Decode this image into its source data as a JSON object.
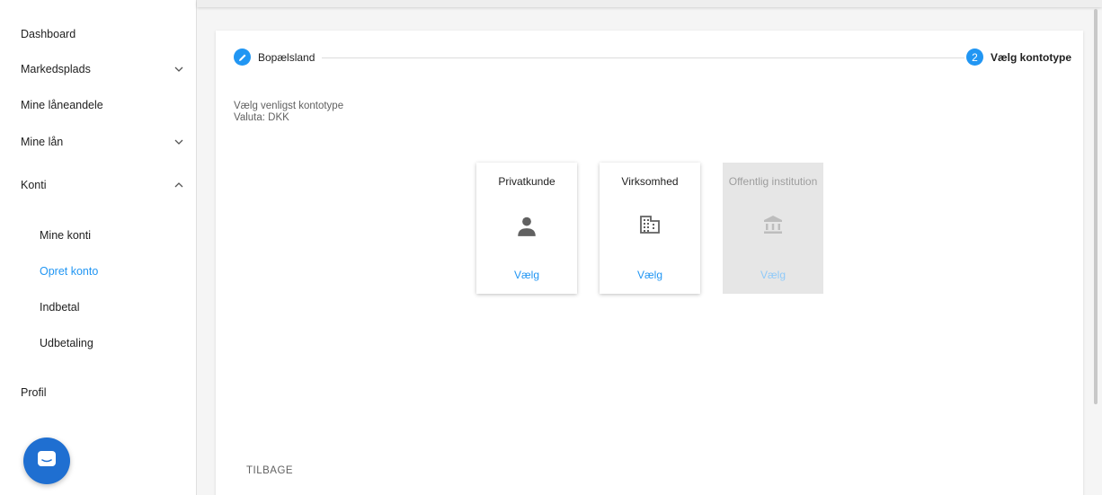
{
  "sidebar": {
    "items": [
      {
        "label": "Dashboard"
      },
      {
        "label": "Markedsplads"
      },
      {
        "label": "Mine låneandele"
      },
      {
        "label": "Mine lån"
      },
      {
        "label": "Konti"
      },
      {
        "label": "Profil"
      }
    ],
    "konti_sub": [
      {
        "label": "Mine konti"
      },
      {
        "label": "Opret konto",
        "active": true
      },
      {
        "label": "Indbetal"
      },
      {
        "label": "Udbetaling"
      }
    ]
  },
  "stepper": {
    "step1_label": "Bopælsland",
    "step2_number": "2",
    "step2_label": "Vælg kontotype"
  },
  "intro": {
    "line1": "Vælg venligst kontotype",
    "line2": "Valuta: DKK"
  },
  "account_types": [
    {
      "title": "Privatkunde",
      "button": "Vælg",
      "icon": "person-icon",
      "disabled": false
    },
    {
      "title": "Virksomhed",
      "button": "Vælg",
      "icon": "business-icon",
      "disabled": false
    },
    {
      "title": "Offentlig institution",
      "button": "Vælg",
      "icon": "institution-icon",
      "disabled": true
    }
  ],
  "back_label": "TILBAGE",
  "colors": {
    "accent": "#2196f3",
    "chat": "#1f6fd1",
    "disabled_card": "#e6e6e6"
  }
}
